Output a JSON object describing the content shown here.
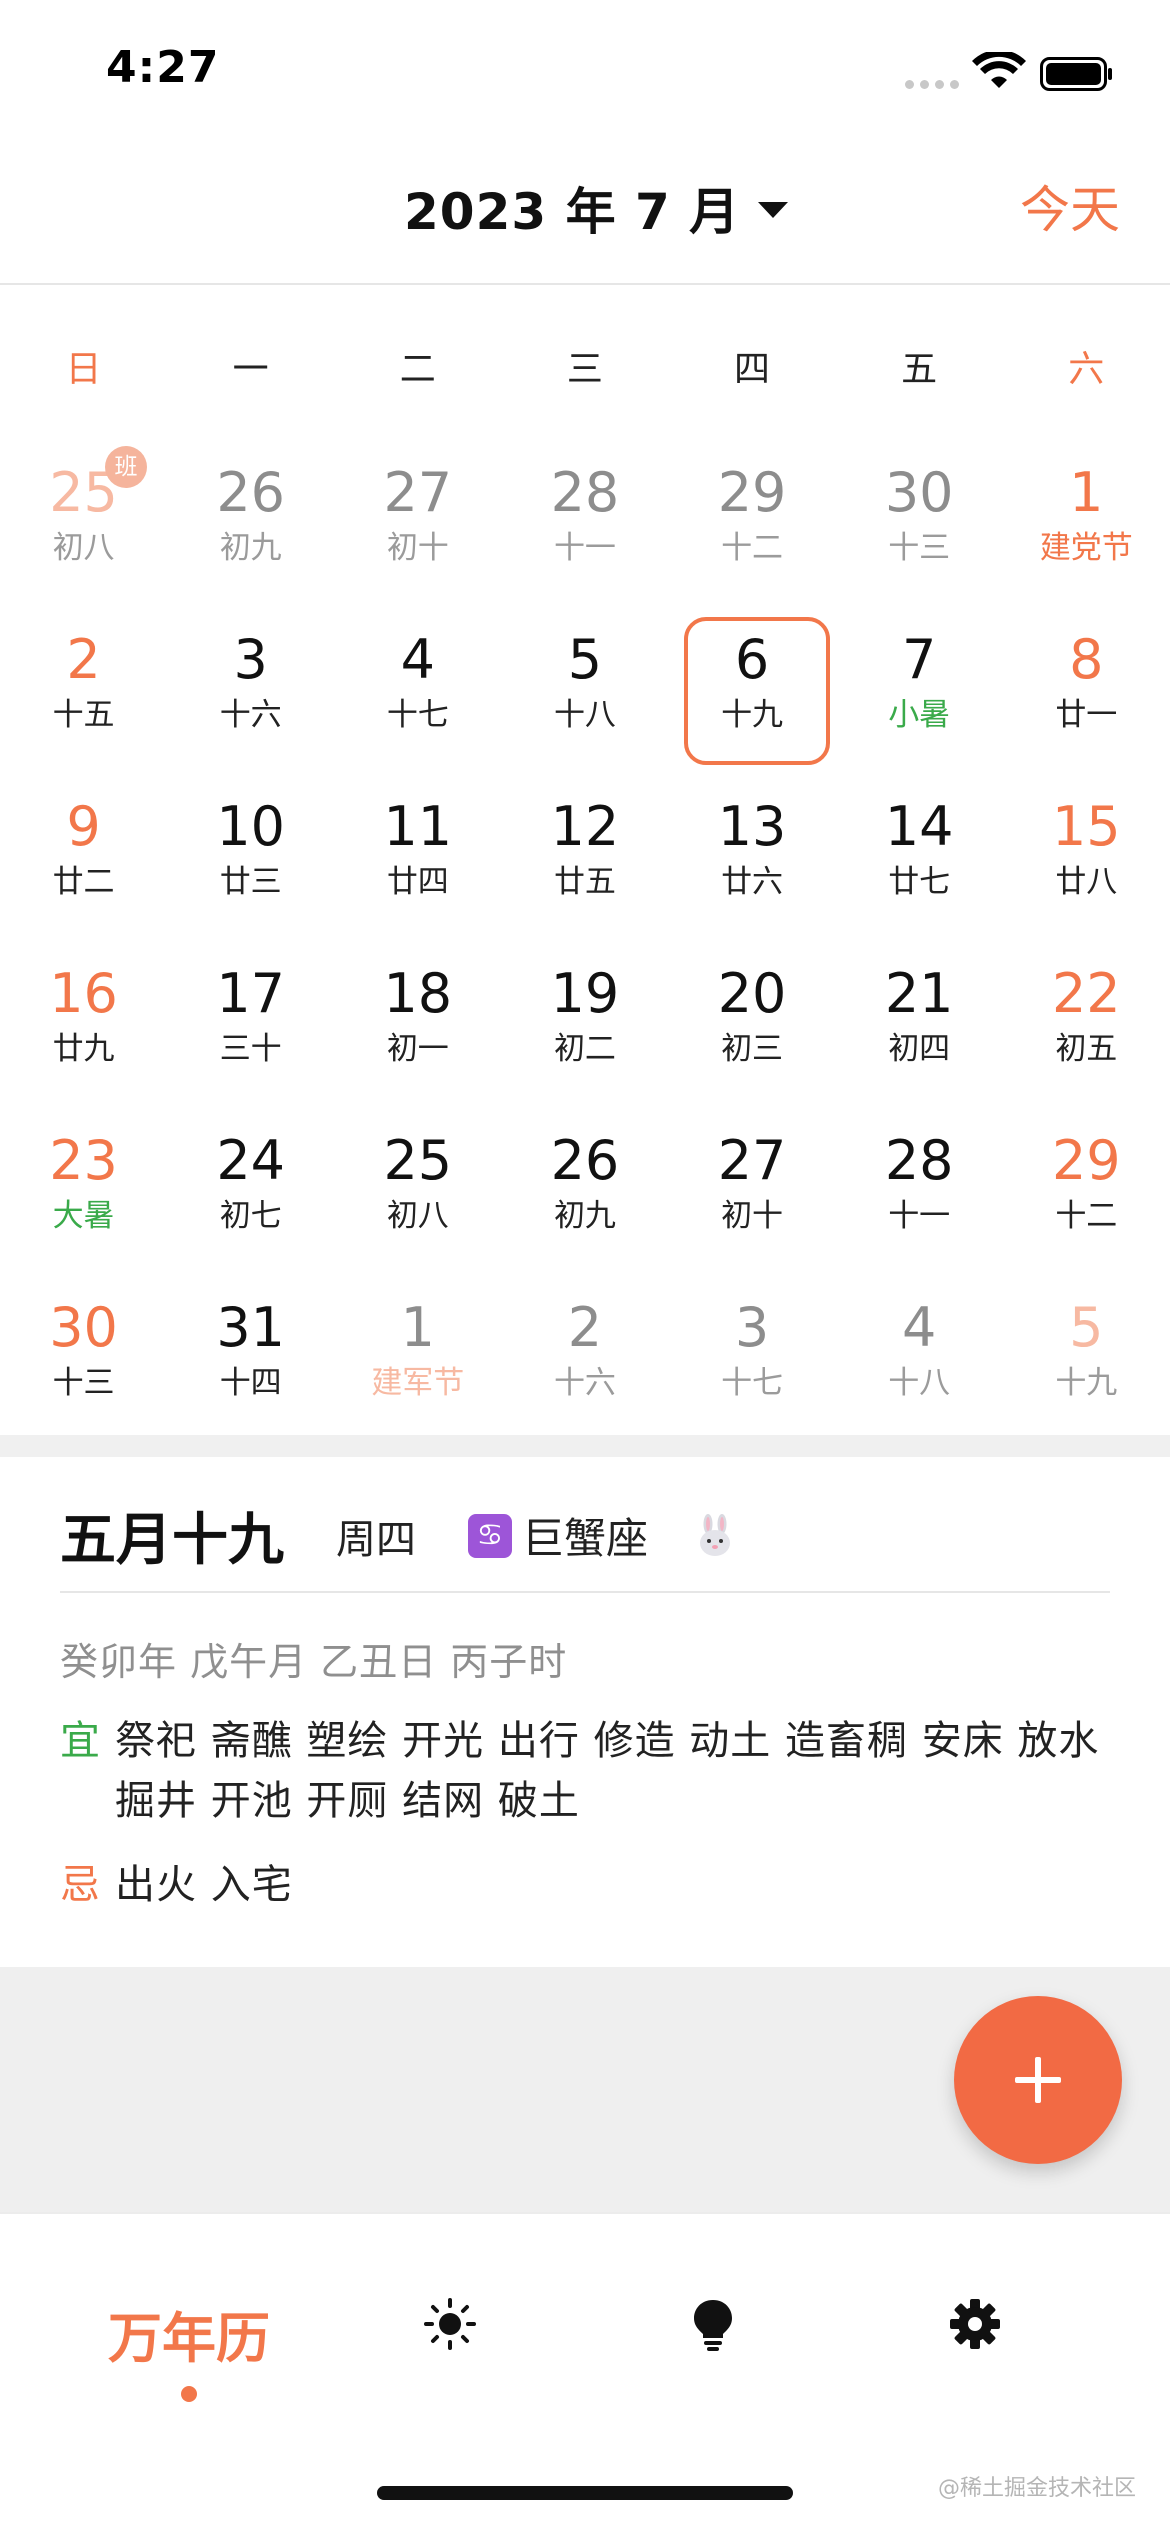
{
  "status_bar": {
    "time": "4:27"
  },
  "header": {
    "month_title": "2023 年 7 月",
    "today_label": "今天"
  },
  "weekdays": [
    "日",
    "一",
    "二",
    "三",
    "四",
    "五",
    "六"
  ],
  "calendar": {
    "weeks": [
      [
        {
          "day": "25",
          "lunar": "初八",
          "other": true,
          "badge": "班"
        },
        {
          "day": "26",
          "lunar": "初九",
          "other": true
        },
        {
          "day": "27",
          "lunar": "初十",
          "other": true
        },
        {
          "day": "28",
          "lunar": "十一",
          "other": true
        },
        {
          "day": "29",
          "lunar": "十二",
          "other": true
        },
        {
          "day": "30",
          "lunar": "十三",
          "other": true
        },
        {
          "day": "1",
          "lunar": "建党节",
          "type": "festival"
        }
      ],
      [
        {
          "day": "2",
          "lunar": "十五"
        },
        {
          "day": "3",
          "lunar": "十六"
        },
        {
          "day": "4",
          "lunar": "十七"
        },
        {
          "day": "5",
          "lunar": "十八"
        },
        {
          "day": "6",
          "lunar": "十九",
          "selected": true
        },
        {
          "day": "7",
          "lunar": "小暑",
          "type": "term"
        },
        {
          "day": "8",
          "lunar": "廿一"
        }
      ],
      [
        {
          "day": "9",
          "lunar": "廿二"
        },
        {
          "day": "10",
          "lunar": "廿三"
        },
        {
          "day": "11",
          "lunar": "廿四"
        },
        {
          "day": "12",
          "lunar": "廿五"
        },
        {
          "day": "13",
          "lunar": "廿六"
        },
        {
          "day": "14",
          "lunar": "廿七"
        },
        {
          "day": "15",
          "lunar": "廿八"
        }
      ],
      [
        {
          "day": "16",
          "lunar": "廿九"
        },
        {
          "day": "17",
          "lunar": "三十"
        },
        {
          "day": "18",
          "lunar": "初一"
        },
        {
          "day": "19",
          "lunar": "初二"
        },
        {
          "day": "20",
          "lunar": "初三"
        },
        {
          "day": "21",
          "lunar": "初四"
        },
        {
          "day": "22",
          "lunar": "初五"
        }
      ],
      [
        {
          "day": "23",
          "lunar": "大暑",
          "type": "term"
        },
        {
          "day": "24",
          "lunar": "初七"
        },
        {
          "day": "25",
          "lunar": "初八"
        },
        {
          "day": "26",
          "lunar": "初九"
        },
        {
          "day": "27",
          "lunar": "初十"
        },
        {
          "day": "28",
          "lunar": "十一"
        },
        {
          "day": "29",
          "lunar": "十二"
        }
      ],
      [
        {
          "day": "30",
          "lunar": "十三"
        },
        {
          "day": "31",
          "lunar": "十四"
        },
        {
          "day": "1",
          "lunar": "建军节",
          "other": true,
          "type": "festival"
        },
        {
          "day": "2",
          "lunar": "十六",
          "other": true
        },
        {
          "day": "3",
          "lunar": "十七",
          "other": true
        },
        {
          "day": "4",
          "lunar": "十八",
          "other": true
        },
        {
          "day": "5",
          "lunar": "十九",
          "other": true
        }
      ]
    ]
  },
  "detail": {
    "lunar_date": "五月十九",
    "weekday": "周四",
    "zodiac_icon": "♋",
    "zodiac": "巨蟹座",
    "animal_icon": "rabbit-icon",
    "ganzhi": "癸卯年 戊午月 乙丑日 丙子时",
    "yi_label": "宜",
    "yi": "祭祀 斋醮 塑绘 开光 出行 修造 动土 造畜稠 安床 放水 掘井 开池 开厕 结网 破土",
    "ji_label": "忌",
    "ji": "出火 入宅"
  },
  "tabbar": {
    "tabs": [
      {
        "label": "万年历",
        "active": true
      },
      {
        "icon": "sun-icon"
      },
      {
        "icon": "lightbulb-icon"
      },
      {
        "icon": "gear-icon"
      }
    ]
  },
  "watermark": "@稀土掘金技术社区",
  "colors": {
    "accent": "#f2774a",
    "term": "#3aaa4a",
    "fab": "#f26a44"
  }
}
